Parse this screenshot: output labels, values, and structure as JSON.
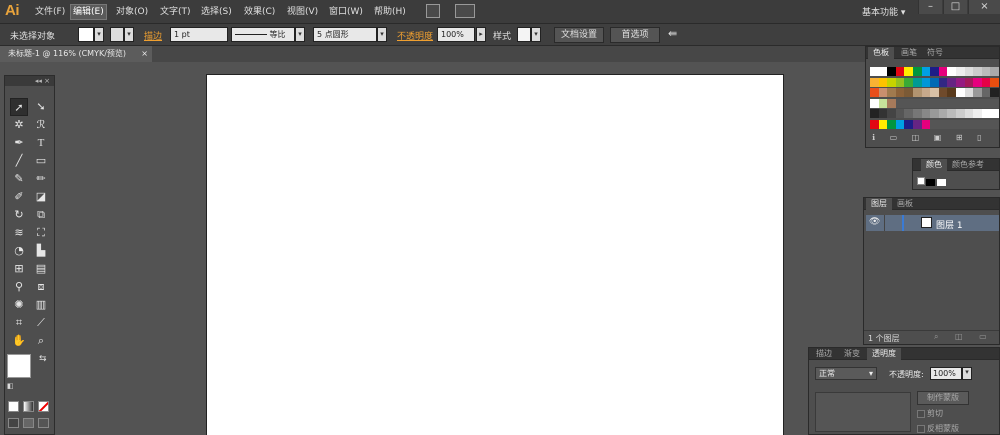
{
  "app": {
    "logo": "Ai"
  },
  "menu": [
    "文件(F)",
    "编辑(E)",
    "对象(O)",
    "文字(T)",
    "选择(S)",
    "效果(C)",
    "视图(V)",
    "窗口(W)",
    "帮助(H)"
  ],
  "workspace": {
    "label": "基本功能 ▾"
  },
  "window_buttons": {
    "minimize": "–",
    "maximize": "□",
    "close": "×"
  },
  "control_bar": {
    "selection_label": "未选择对象",
    "stroke_label": "描边",
    "stroke_weight": "1 pt",
    "uniform_label": "等比",
    "brush_label": "5 点圆形",
    "opacity_label": "不透明度",
    "opacity_value": "100%",
    "style_label": "样式",
    "doc_setup_button": "文档设置",
    "prefs_button": "首选项"
  },
  "document_tab": {
    "title": "未标题-1 @ 116% (CMYK/预览)",
    "close": "×"
  },
  "swatches_panel": {
    "tabs": [
      "色板",
      "画笔",
      "符号"
    ]
  },
  "color_panel": {
    "tabs": [
      "颜色",
      "颜色参考"
    ]
  },
  "layers_panel": {
    "tabs": [
      "图层",
      "画板"
    ],
    "layer_name": "图层 1",
    "footer": "1 个图层"
  },
  "transparency_panel": {
    "tabs": [
      "描边",
      "渐变",
      "透明度"
    ],
    "blend_mode": "正常",
    "opacity_label": "不透明度:",
    "opacity_value": "100%",
    "mask_button": "制作蒙版",
    "clip_label": "剪切",
    "invert_label": "反相蒙版"
  },
  "colors": {
    "accent_orange": "#e8a33b",
    "artboard": "#ffffff",
    "panel_bg": "#4e4e4e",
    "app_bg": "#535353"
  }
}
